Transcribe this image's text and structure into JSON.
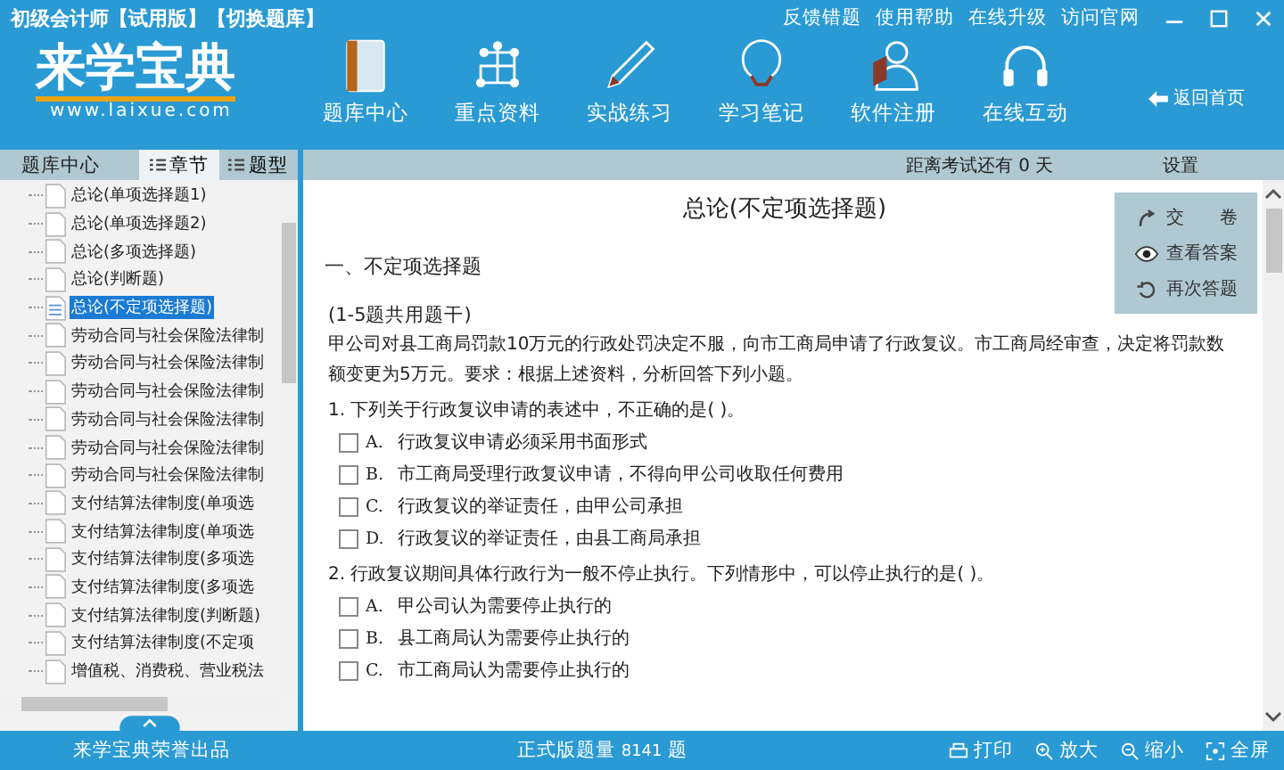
{
  "window": {
    "title": "初级会计师【试用版】【切换题库】",
    "links": [
      "反馈错题",
      "使用帮助",
      "在线升级",
      "访问官网"
    ]
  },
  "logo": {
    "name": "来学宝典",
    "url": "www.laixue.com"
  },
  "nav": [
    {
      "label": "题库中心",
      "kind": "book"
    },
    {
      "label": "重点资料",
      "kind": "network"
    },
    {
      "label": "实战练习",
      "kind": "pencil"
    },
    {
      "label": "学习笔记",
      "kind": "bulb"
    },
    {
      "label": "软件注册",
      "kind": "user"
    },
    {
      "label": "在线互动",
      "kind": "headset"
    }
  ],
  "back_link": "返回首页",
  "sidebar": {
    "title": "题库中心",
    "tabs": [
      {
        "label": "章节",
        "selected": true
      },
      {
        "label": "题型",
        "selected": false
      }
    ],
    "items": [
      {
        "label": "总论(单项选择题1)",
        "selected": false
      },
      {
        "label": "总论(单项选择题2)",
        "selected": false
      },
      {
        "label": "总论(多项选择题)",
        "selected": false
      },
      {
        "label": "总论(判断题)",
        "selected": false
      },
      {
        "label": "总论(不定项选择题)",
        "selected": true
      },
      {
        "label": "劳动合同与社会保险法律制",
        "selected": false
      },
      {
        "label": "劳动合同与社会保险法律制",
        "selected": false
      },
      {
        "label": "劳动合同与社会保险法律制",
        "selected": false
      },
      {
        "label": "劳动合同与社会保险法律制",
        "selected": false
      },
      {
        "label": "劳动合同与社会保险法律制",
        "selected": false
      },
      {
        "label": "劳动合同与社会保险法律制",
        "selected": false
      },
      {
        "label": "支付结算法律制度(单项选",
        "selected": false
      },
      {
        "label": "支付结算法律制度(单项选",
        "selected": false
      },
      {
        "label": "支付结算法律制度(多项选",
        "selected": false
      },
      {
        "label": "支付结算法律制度(多项选",
        "selected": false
      },
      {
        "label": "支付结算法律制度(判断题)",
        "selected": false
      },
      {
        "label": "支付结算法律制度(不定项",
        "selected": false
      },
      {
        "label": "增值税、消费税、营业税法",
        "selected": false
      }
    ],
    "footer": "来学宝典荣誉出品"
  },
  "countdown": "距离考试还有 0 天",
  "settings": "设置",
  "actions": [
    {
      "label": "交　　卷",
      "kind": "submit"
    },
    {
      "label": "查看答案",
      "kind": "eye"
    },
    {
      "label": "再次答题",
      "kind": "retry"
    }
  ],
  "content": {
    "title": "总论(不定项选择题)",
    "section": "一、不定项选择题",
    "stem_note": "(1-5题共用题干)",
    "stem": "甲公司对县工商局罚款10万元的行政处罚决定不服，向市工商局申请了行政复议。市工商局经审查，决定将罚款数额变更为5万元。要求：根据上述资料，分析回答下列小题。",
    "questions": [
      {
        "text": "1. 下列关于行政复议申请的表述中，不正确的是( )。",
        "options": [
          {
            "letter": "A.",
            "text": "行政复议申请必须采用书面形式",
            "checked": false
          },
          {
            "letter": "B.",
            "text": "市工商局受理行政复议申请，不得向甲公司收取任何费用",
            "checked": false
          },
          {
            "letter": "C.",
            "text": "行政复议的举证责任，由甲公司承担",
            "checked": false
          },
          {
            "letter": "D.",
            "text": "行政复议的举证责任，由县工商局承担",
            "checked": false
          }
        ]
      },
      {
        "text": "2. 行政复议期间具体行政行为一般不停止执行。下列情形中，可以停止执行的是( )。",
        "options": [
          {
            "letter": "A.",
            "text": "甲公司认为需要停止执行的",
            "checked": false
          },
          {
            "letter": "B.",
            "text": "县工商局认为需要停止执行的",
            "checked": false
          },
          {
            "letter": "C.",
            "text": "市工商局认为需要停止执行的",
            "checked": false
          }
        ]
      }
    ]
  },
  "status_bar": {
    "count_label": "正式版题量",
    "count": "8141",
    "unit": "题",
    "tools": [
      {
        "label": "打印",
        "kind": "print"
      },
      {
        "label": "放大",
        "kind": "zoom-in"
      },
      {
        "label": "缩小",
        "kind": "zoom-out"
      },
      {
        "label": "全屏",
        "kind": "fullscreen"
      }
    ]
  }
}
